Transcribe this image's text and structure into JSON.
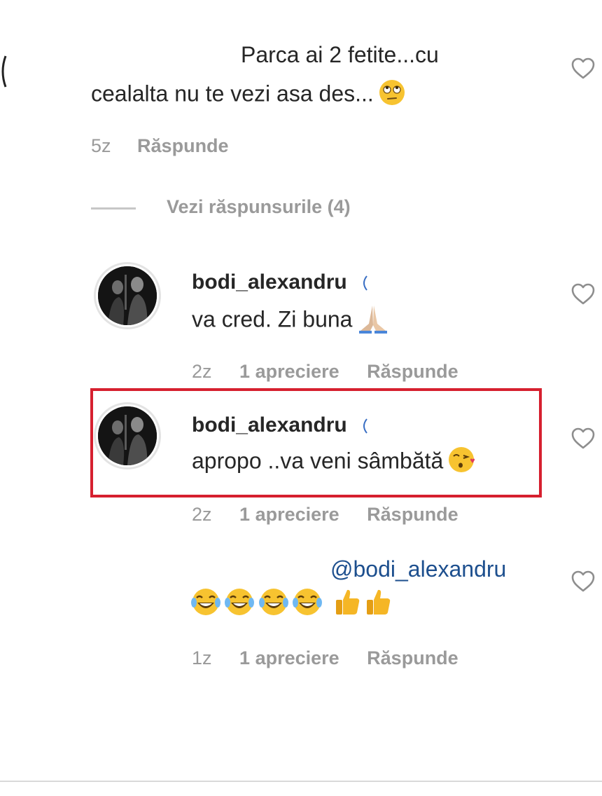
{
  "comment1": {
    "line1": "Parca ai 2 fetite...cu",
    "line2": "cealalta nu te vezi asa des...",
    "time": "5z",
    "reply": "Răspunde"
  },
  "view_replies": {
    "label": "Vezi răspunsurile (4)"
  },
  "reply1": {
    "username": "bodi_alexandru",
    "text": "va cred. Zi buna",
    "time": "2z",
    "likes": "1 apreciere",
    "reply": "Răspunde"
  },
  "reply2": {
    "username": "bodi_alexandru",
    "text": "apropo ..va veni sâmbătă",
    "time": "2z",
    "likes": "1 apreciere",
    "reply": "Răspunde"
  },
  "reply3": {
    "mention": "@bodi_alexandru",
    "time": "1z",
    "likes": "1 apreciere",
    "reply": "Răspunde"
  },
  "icons": {
    "heart": "heart-outline-icon",
    "emoji_rolling_eyes": "face-rolling-eyes-icon",
    "emoji_praying": "folded-hands-icon",
    "emoji_kiss": "face-blowing-kiss-icon",
    "emoji_laugh": "face-tears-of-joy-icon",
    "emoji_thumbs": "thumbs-up-icon"
  },
  "colors": {
    "highlight": "#d6202f",
    "mention": "#1d4f8e",
    "meta": "#9a9a9a"
  }
}
